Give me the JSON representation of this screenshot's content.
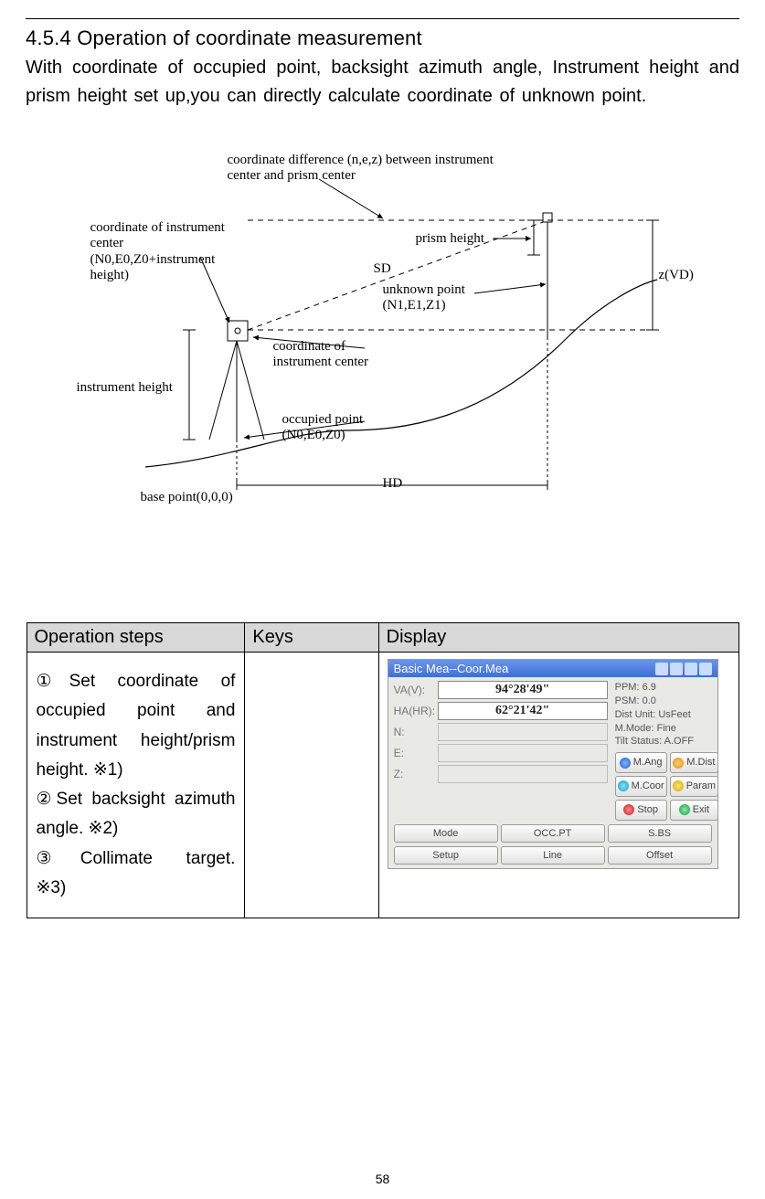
{
  "section_number": "4.5.4",
  "section_title": "Operation of coordinate measurement",
  "intro": "With coordinate of occupied point, backsight azimuth angle, Instrument height and prism height set up,you can directly calculate coordinate of unknown point.",
  "page_number": "58",
  "diagram": {
    "label_coord_diff": "coordinate difference (n,e,z) between instrument center and prism center",
    "label_instr_center": "coordinate of instrument center (N0,E0,Z0+instrument height)",
    "label_prism_height": "prism height",
    "label_sd": "SD",
    "label_zvd": "z(VD)",
    "label_unknown": "unknown point (N1,E1,Z1)",
    "label_coord_instr_center2": "coordinate of instrument center",
    "label_instr_height": "instrument height",
    "label_occupied": "occupied point (N0,E0,Z0)",
    "label_hd": "HD",
    "label_base": "base point(0,0,0)"
  },
  "table": {
    "headers": {
      "steps": "Operation steps",
      "keys": "Keys",
      "display": "Display"
    },
    "steps": {
      "s1a": "①Set coordinate of",
      "s1b": "occupied point and",
      "s1c": "instrument height/prism",
      "s1d": "height.  ※1)",
      "s2a": "②Set backsight azimuth",
      "s2b": "angle.  ※2)",
      "s3a": "③Collimate target.",
      "s3b": "※3)"
    },
    "device": {
      "title": "Basic Mea--Coor.Mea",
      "va_label": "VA(V):",
      "va_value": "94°28'49\"",
      "ha_label": "HA(HR):",
      "ha_value": "62°21'42\"",
      "n_label": "N:",
      "e_label": "E:",
      "z_label": "Z:",
      "ppm_label": "PPM:",
      "ppm_value": "6.9",
      "psm_label": "PSM:",
      "psm_value": "0.0",
      "du_label": "Dist Unit:",
      "du_value": "UsFeet",
      "mm_label": "M.Mode:",
      "mm_value": "Fine",
      "ts_label": "Tilt Status:",
      "ts_value": "A.OFF",
      "btn_mang": "M.Ang",
      "btn_mdist": "M.Dist",
      "btn_mcoor": "M.Coor",
      "btn_param": "Param",
      "btn_stop": "Stop",
      "btn_exit": "Exit",
      "btn_mode": "Mode",
      "btn_occpt": "OCC.PT",
      "btn_sbs": "S.BS",
      "btn_setup": "Setup",
      "btn_line": "Line",
      "btn_offset": "Offset"
    }
  }
}
